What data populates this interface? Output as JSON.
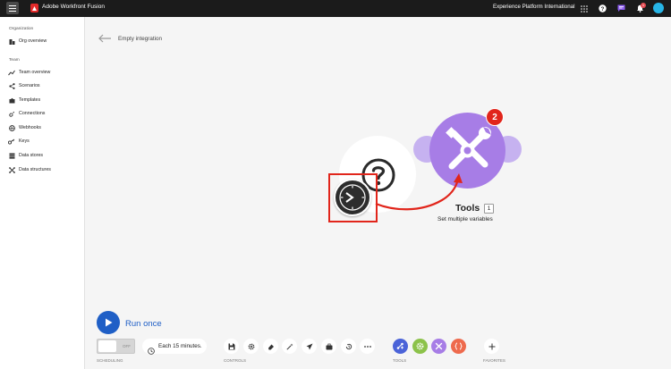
{
  "topbar": {
    "app_name": "Adobe Workfront Fusion",
    "org_name": "Experience Platform International",
    "notification_count": "1"
  },
  "sidebar": {
    "org_section": "Organization",
    "org_items": [
      {
        "label": "Org overview",
        "icon": "building-icon"
      }
    ],
    "team_section": "Team",
    "team_items": [
      {
        "label": "Team overview",
        "icon": "trend-icon"
      },
      {
        "label": "Scenarios",
        "icon": "share-icon"
      },
      {
        "label": "Templates",
        "icon": "puzzle-icon"
      },
      {
        "label": "Connections",
        "icon": "link-icon"
      },
      {
        "label": "Webhooks",
        "icon": "globe-icon"
      },
      {
        "label": "Keys",
        "icon": "key-icon"
      },
      {
        "label": "Data stores",
        "icon": "database-icon"
      },
      {
        "label": "Data structures",
        "icon": "structure-icon"
      }
    ]
  },
  "header": {
    "title": "Empty integration"
  },
  "canvas": {
    "tools_module": {
      "title": "Tools",
      "count": "1",
      "subtitle": "Set multiple variables",
      "badge": "2",
      "color": "#a77de6"
    },
    "highlight_color": "#e1251b"
  },
  "bottom": {
    "run_label": "Run once",
    "toggle_state": "OFF",
    "schedule_text": "Each 15 minutes.",
    "scheduling_label": "SCHEDULING",
    "controls_label": "CONTROLS",
    "tools_label": "TOOLS",
    "favorites_label": "FAVORITES",
    "accent": "#1f5fc6"
  }
}
